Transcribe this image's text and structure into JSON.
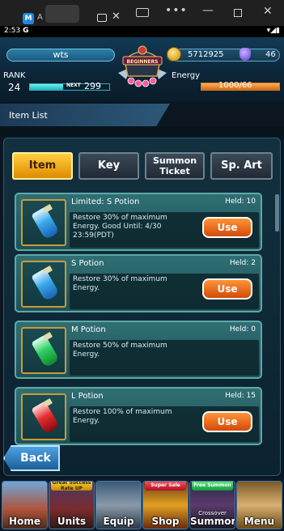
{
  "window": {
    "tab1_text": "A",
    "close_glyph": "✕",
    "more_glyph": "•••",
    "minimize_glyph": "—",
    "maximize_glyph": "",
    "close_window_glyph": "✕"
  },
  "status_bar": {
    "time": "2:53",
    "indicator": "G",
    "icons": "▾◢▮"
  },
  "header": {
    "player_name": "wts",
    "gold": "5712925",
    "gems": "46",
    "crest_text": "BEGINNERS",
    "rank_label": "RANK",
    "rank_value": "24",
    "next_label": "NEXT",
    "next_value": "299",
    "exp_progress": 0.42,
    "energy_label": "Energy",
    "energy_value": "1000/66",
    "energy_progress": 1.0
  },
  "list_title": "Item List",
  "tabs": {
    "item": "Item",
    "key": "Key",
    "summon_ticket": "Summon\nTicket",
    "sp_art": "Sp. Art",
    "active": "item"
  },
  "items": [
    {
      "name": "Limited: S Potion",
      "held_label": "Held: 10",
      "description": "Restore 30% of maximum\nEnergy. Good Until: 4/30\n23:59(PDT)",
      "use_label": "Use",
      "potion_color": "blue"
    },
    {
      "name": "S Potion",
      "held_label": "Held: 2",
      "description": "Restore 30% of maximum\nEnergy.",
      "use_label": "Use",
      "potion_color": "blue"
    },
    {
      "name": "M Potion",
      "held_label": "Held: 0",
      "description": "Restore 50% of maximum\nEnergy.",
      "use_label": "",
      "potion_color": "green"
    },
    {
      "name": "L Potion",
      "held_label": "Held: 15",
      "description": "Restore 100% of maximum\nEnergy.",
      "use_label": "Use",
      "potion_color": "red"
    }
  ],
  "back_label": "Back",
  "bottom_nav": {
    "home": "Home",
    "units": "Units",
    "units_badge": "Great Success Rate UP",
    "equip": "Equip",
    "shop": "Shop",
    "shop_badge": "Super Sale",
    "summon": "Summon",
    "summon_badge": "Free Summon",
    "summon_sub": "Crossover",
    "menu": "Menu"
  },
  "colors": {
    "accent_orange": "#e08a00",
    "use_button": "#d34a08",
    "card_teal": "#2f6f74",
    "back_blue": "#1b5e9a"
  }
}
